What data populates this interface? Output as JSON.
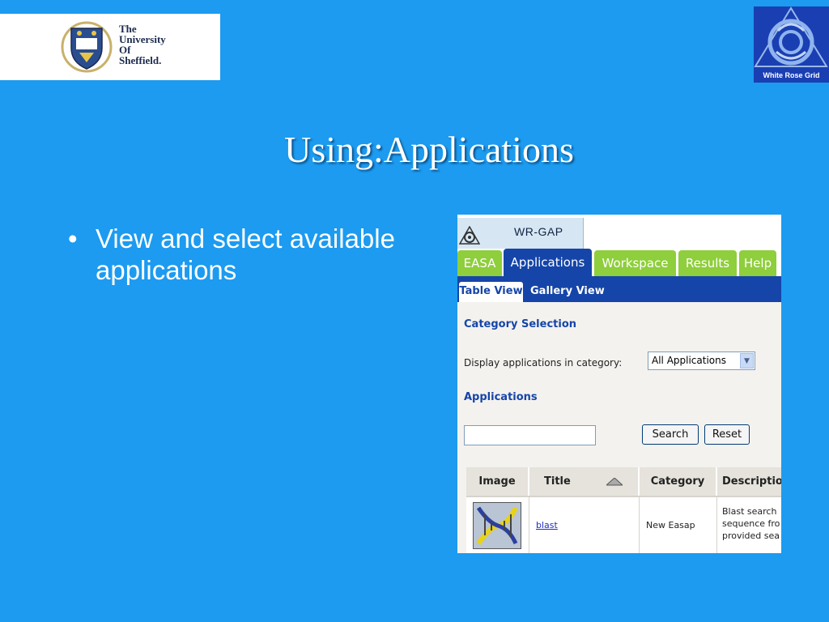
{
  "branding": {
    "university_lines": [
      "The",
      "University",
      "Of",
      "Sheffield."
    ],
    "grid_logo_label": "White Rose Grid"
  },
  "slide": {
    "title": "Using:Applications",
    "bullets": [
      "View and select available applications"
    ],
    "bullet_symbol": "•"
  },
  "app": {
    "brand_name": "WR-GAP",
    "tabs": [
      {
        "label": "EASA",
        "active": false
      },
      {
        "label": "Applications",
        "active": true
      },
      {
        "label": "Workspace",
        "active": false
      },
      {
        "label": "Results",
        "active": false
      },
      {
        "label": "Help",
        "active": false
      }
    ],
    "subtabs": [
      {
        "label": "Table View",
        "active": true
      },
      {
        "label": "Gallery View",
        "active": false
      }
    ],
    "category_heading": "Category Selection",
    "category_label": "Display applications in category:",
    "category_select_value": "All Applications",
    "applications_heading": "Applications",
    "search_input_value": "",
    "search_button": "Search",
    "reset_button": "Reset",
    "table": {
      "headers": [
        "Image",
        "Title",
        "Category",
        "Descriptio"
      ],
      "rows": [
        {
          "title": "blast",
          "category": "New Easap",
          "description_lines": [
            "Blast search",
            "sequence fro",
            "provided sea"
          ]
        }
      ]
    }
  },
  "colors": {
    "slide_background": "#1c9bf0",
    "tab_green": "#8fce3c",
    "tab_active_blue": "#1545a8",
    "heading_blue": "#1545a8"
  }
}
